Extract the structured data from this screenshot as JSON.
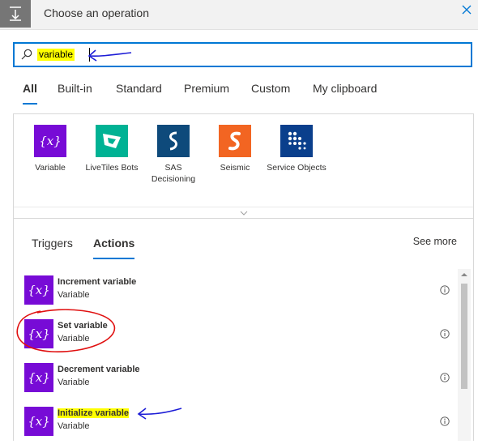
{
  "header": {
    "title": "Choose an operation"
  },
  "search": {
    "value": "variable"
  },
  "tabs": [
    {
      "label": "All",
      "active": true
    },
    {
      "label": "Built-in"
    },
    {
      "label": "Standard"
    },
    {
      "label": "Premium"
    },
    {
      "label": "Custom"
    },
    {
      "label": "My clipboard"
    }
  ],
  "connectors": [
    {
      "label": "Variable",
      "color": "#770bd6",
      "icon": "variable-icon"
    },
    {
      "label": "LiveTiles Bots",
      "color": "#00b294",
      "icon": "livetiles-icon"
    },
    {
      "label": "SAS Decisioning",
      "color": "#0e4a7b",
      "icon": "sas-icon"
    },
    {
      "label": "Seismic",
      "color": "#f26522",
      "icon": "seismic-icon"
    },
    {
      "label": "Service Objects",
      "color": "#0a3f8c",
      "icon": "service-objects-icon"
    }
  ],
  "subtabs": [
    {
      "label": "Triggers"
    },
    {
      "label": "Actions",
      "active": true
    }
  ],
  "see_more": "See more",
  "actions": [
    {
      "title": "Increment variable",
      "sub": "Variable"
    },
    {
      "title": "Set variable",
      "sub": "Variable"
    },
    {
      "title": "Decrement variable",
      "sub": "Variable"
    },
    {
      "title": "Initialize variable",
      "sub": "Variable"
    }
  ],
  "icon_glyph": "{x}"
}
